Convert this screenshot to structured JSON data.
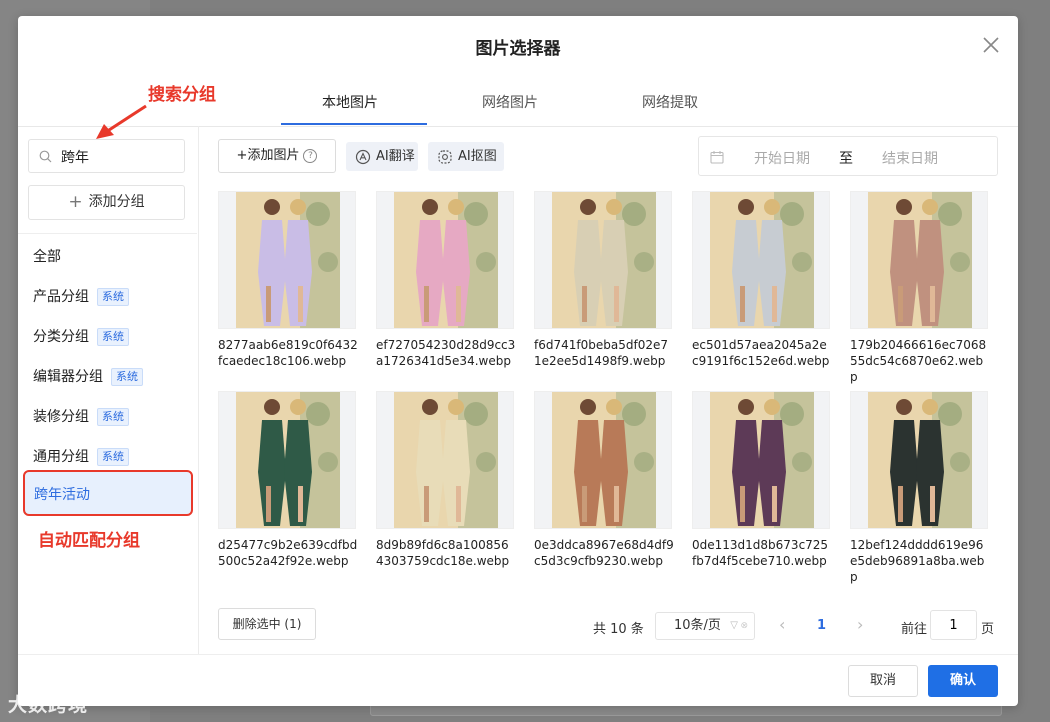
{
  "dialog": {
    "title": "图片选择器"
  },
  "tabs": [
    {
      "label": "本地图片"
    },
    {
      "label": "网络图片"
    },
    {
      "label": "网络提取"
    }
  ],
  "annotations": {
    "search_note": "搜索分组",
    "match_note": "自动匹配分组"
  },
  "sidebar": {
    "search_value": "跨年",
    "add_group_label": "添加分组",
    "groups": [
      {
        "label": "全部",
        "badge": ""
      },
      {
        "label": "产品分组",
        "badge": "系统"
      },
      {
        "label": "分类分组",
        "badge": "系统"
      },
      {
        "label": "编辑器分组",
        "badge": "系统"
      },
      {
        "label": "装修分组",
        "badge": "系统"
      },
      {
        "label": "通用分组",
        "badge": "系统"
      },
      {
        "label": "跨年活动",
        "badge": ""
      }
    ]
  },
  "toolbar": {
    "add_image_label": "+添加图片",
    "help_glyph": "?",
    "ai_translate_label": "AI翻译",
    "ai_cutout_label": "AI抠图",
    "start_date_placeholder": "开始日期",
    "range_separator": "至",
    "end_date_placeholder": "结束日期"
  },
  "images": [
    {
      "name": "8277aab6e819c0f6432fcaedec18c106.webp",
      "dress_color": "#c9bde6"
    },
    {
      "name": "ef727054230d28d9cc3a1726341d5e34.webp",
      "dress_color": "#e6a9c3"
    },
    {
      "name": "f6d741f0beba5df02e71e2ee5d1498f9.webp",
      "dress_color": "#d8cfb4"
    },
    {
      "name": "ec501d57aea2045a2ec9191f6c152e6d.webp",
      "dress_color": "#c7ccd2"
    },
    {
      "name": "179b20466616ec706855dc54c6870e62.webp",
      "dress_color": "#c0917f"
    },
    {
      "name": "d25477c9b2e639cdfbd500c52a42f92e.webp",
      "dress_color": "#2f5a47"
    },
    {
      "name": "8d9b89fd6c8a1008564303759cdc18e.webp",
      "dress_color": "#e8dcb8"
    },
    {
      "name": "0e3ddca8967e68d4df9c5d3c9cfb9230.webp",
      "dress_color": "#b87a58"
    },
    {
      "name": "0de113d1d8b673c725fb7d4f5cebe710.webp",
      "dress_color": "#5d3a57"
    },
    {
      "name": "12bef124dddd619e96e5deb96891a8ba.webp",
      "dress_color": "#2b3330"
    }
  ],
  "footer_bar": {
    "delete_label": "删除选中 (1)",
    "total_label": "共 10 条",
    "page_size_label": "10条/页",
    "current_page": "1",
    "goto_label": "前往",
    "goto_value": "1",
    "page_suffix": "页"
  },
  "actions": {
    "cancel_label": "取消",
    "confirm_label": "确认"
  },
  "watermark": "大数跨境",
  "colors": {
    "accent": "#1f6fe5",
    "annotation_red": "#e8392b",
    "active_bg": "#e7f0fd"
  }
}
